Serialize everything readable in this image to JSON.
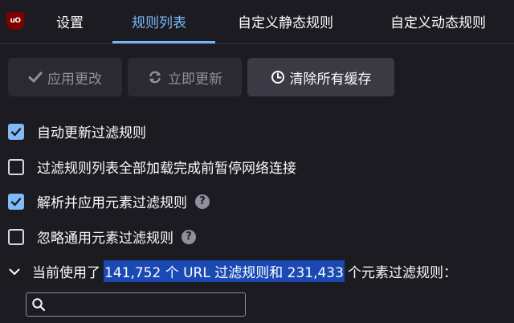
{
  "logo": {
    "text": "uO"
  },
  "tabs": [
    {
      "label": "设置"
    },
    {
      "label": "规则列表"
    },
    {
      "label": "自定义静态规则"
    },
    {
      "label": "自定义动态规则"
    }
  ],
  "toolbar": {
    "apply_label": "应用更改",
    "update_label": "立即更新",
    "purge_label": "清除所有缓存"
  },
  "options": [
    {
      "label": "自动更新过滤规则",
      "checked": true
    },
    {
      "label": "过滤规则列表全部加载完成前暂停网络连接",
      "checked": false
    },
    {
      "label": "解析并应用元素过滤规则",
      "checked": true,
      "help": "?"
    },
    {
      "label": "忽略通用元素过滤规则",
      "checked": false,
      "help": "?"
    }
  ],
  "stats": {
    "prefix": "当前使用了",
    "highlight": "141,752 个 URL 过滤规则和 231,433",
    "suffix": "个元素过滤规则："
  },
  "search": {
    "placeholder": "",
    "value": ""
  },
  "colors": {
    "accent": "#78b7f7",
    "checkbox": "#80bbf8",
    "selection": "#1a49b3",
    "background": "#1c1b22"
  },
  "icons": {
    "logo": "ublock-origin-icon",
    "apply": "checkmark-icon",
    "update": "refresh-icon",
    "purge": "clock-icon",
    "expand": "chevron-down-icon",
    "search": "search-icon"
  }
}
